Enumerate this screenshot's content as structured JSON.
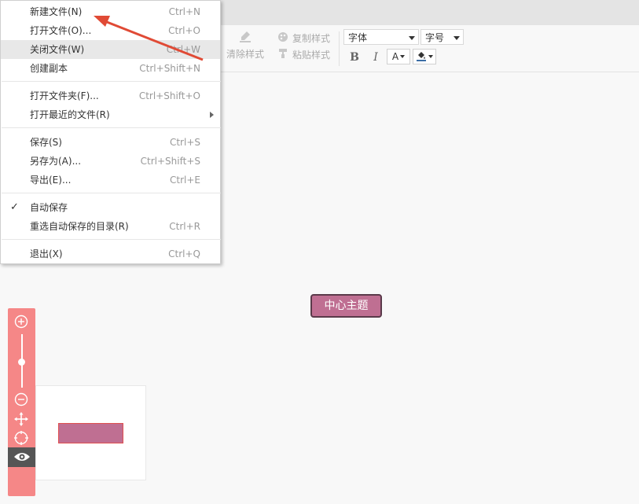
{
  "toolbar": {
    "clear_style": "清除样式",
    "copy_style": "复制样式",
    "paste_style": "粘贴样式",
    "font_select": "字体",
    "size_select": "字号",
    "bold": "B",
    "italic": "I",
    "font_color": "A"
  },
  "file_menu": {
    "items": [
      {
        "label": "新建文件(N)",
        "shortcut": "Ctrl+N"
      },
      {
        "label": "打开文件(O)...",
        "shortcut": "Ctrl+O"
      },
      {
        "label": "关闭文件(W)",
        "shortcut": "Ctrl+W"
      },
      {
        "label": "创建副本",
        "shortcut": "Ctrl+Shift+N"
      },
      {
        "label": "打开文件夹(F)...",
        "shortcut": "Ctrl+Shift+O"
      },
      {
        "label": "打开最近的文件(R)",
        "shortcut": ""
      },
      {
        "label": "保存(S)",
        "shortcut": "Ctrl+S"
      },
      {
        "label": "另存为(A)...",
        "shortcut": "Ctrl+Shift+S"
      },
      {
        "label": "导出(E)...",
        "shortcut": "Ctrl+E"
      },
      {
        "label": "自动保存",
        "shortcut": ""
      },
      {
        "label": "重选自动保存的目录(R)",
        "shortcut": "Ctrl+R"
      },
      {
        "label": "退出(X)",
        "shortcut": "Ctrl+Q"
      }
    ],
    "highlighted": "关闭文件(W)",
    "checked": "自动保存"
  },
  "canvas": {
    "central_topic": "中心主题"
  },
  "colors": {
    "topic_fill": "#bf6f92",
    "topic_border": "#5a3a4a",
    "zoom_panel": "#f58787",
    "annotation_arrow": "#e04a35"
  },
  "icons": [
    "eraser-icon",
    "palette-icon",
    "paint-roller-icon",
    "zoom-in-icon",
    "zoom-out-icon",
    "move-icon",
    "locate-icon",
    "eye-icon",
    "fill-color-icon",
    "check-icon",
    "submenu-arrow-icon"
  ]
}
